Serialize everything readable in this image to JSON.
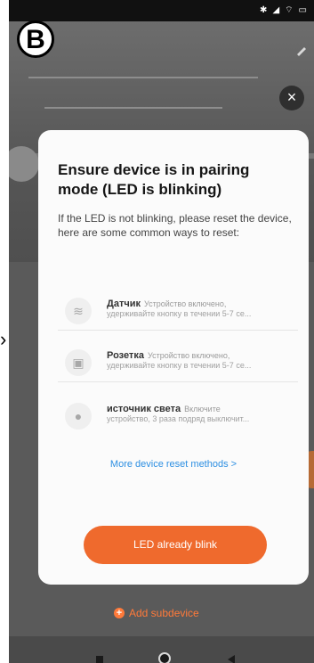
{
  "badge": {
    "label": "B"
  },
  "status": {
    "icons": [
      "bluetooth-icon",
      "signal-icon",
      "wifi-icon",
      "battery-icon"
    ]
  },
  "dialog": {
    "title": "Ensure device is in pairing mode (LED is blinking)",
    "description": "If the LED is not blinking, please reset the device, here are some common ways to reset:",
    "close_label": "×",
    "methods": [
      {
        "name": "Датчик",
        "line1": "Устройство включено,",
        "line2": "удерживайте кнопку в течении 5-7 се..."
      },
      {
        "name": "Розетка",
        "line1": "Устройство включено,",
        "line2": "удерживайте кнопку в течении 5-7 се..."
      },
      {
        "name": "источник света",
        "line1": "Включите",
        "line2": "устройство, 3 раза подряд выключит..."
      }
    ],
    "more_link": "More device reset methods >",
    "primary_button": "LED already blink"
  },
  "background": {
    "add_subdevice": "Add subdevice"
  },
  "colors": {
    "accent": "#ef6a2d",
    "link": "#2d8fe2",
    "arrow": "#e0161d"
  }
}
